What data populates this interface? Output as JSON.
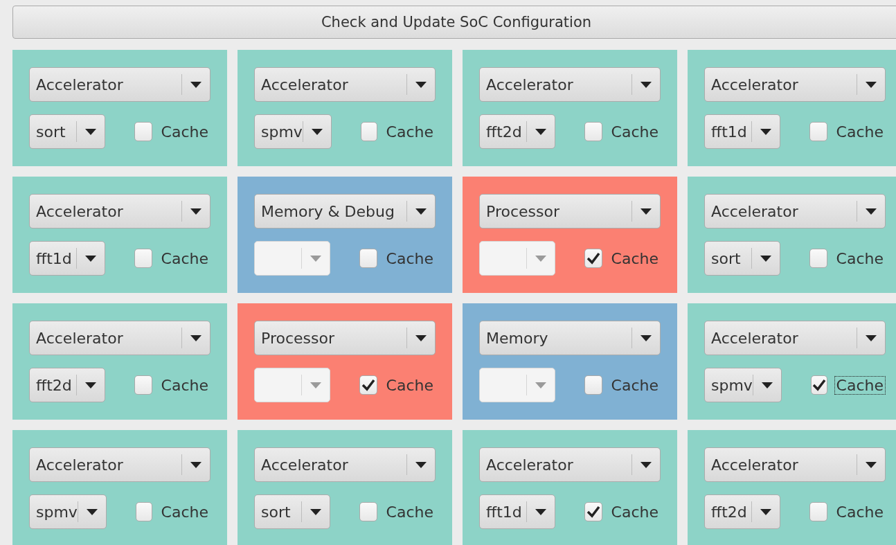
{
  "update_button": "Check and Update SoC Configuration",
  "tiles": [
    {
      "type": "Accelerator",
      "color": "#8dd3c7",
      "accelerator": "sort",
      "disabled": false,
      "cache": "Cache",
      "checked": false,
      "focused": false
    },
    {
      "type": "Accelerator",
      "color": "#8dd3c7",
      "accelerator": "spmv",
      "disabled": false,
      "cache": "Cache",
      "checked": false,
      "focused": false
    },
    {
      "type": "Accelerator",
      "color": "#8dd3c7",
      "accelerator": "fft2d",
      "disabled": false,
      "cache": "Cache",
      "checked": false,
      "focused": false
    },
    {
      "type": "Accelerator",
      "color": "#8dd3c7",
      "accelerator": "fft1d",
      "disabled": false,
      "cache": "Cache",
      "checked": false,
      "focused": false
    },
    {
      "type": "Accelerator",
      "color": "#8dd3c7",
      "accelerator": "fft1d",
      "disabled": false,
      "cache": "Cache",
      "checked": false,
      "focused": false
    },
    {
      "type": "Memory & Debug",
      "color": "#80b1d3",
      "disabled": true,
      "cache": "Cache",
      "checked": false,
      "focused": false
    },
    {
      "type": "Processor",
      "color": "#fb8072",
      "disabled": true,
      "cache": "Cache",
      "checked": true,
      "focused": false
    },
    {
      "type": "Accelerator",
      "color": "#8dd3c7",
      "accelerator": "sort",
      "disabled": false,
      "cache": "Cache",
      "checked": false,
      "focused": false
    },
    {
      "type": "Accelerator",
      "color": "#8dd3c7",
      "accelerator": "fft2d",
      "disabled": false,
      "cache": "Cache",
      "checked": false,
      "focused": false
    },
    {
      "type": "Processor",
      "color": "#fb8072",
      "disabled": true,
      "cache": "Cache",
      "checked": true,
      "focused": false
    },
    {
      "type": "Memory",
      "color": "#80b1d3",
      "disabled": true,
      "cache": "Cache",
      "checked": false,
      "focused": false
    },
    {
      "type": "Accelerator",
      "color": "#8dd3c7",
      "accelerator": "spmv",
      "disabled": false,
      "cache": "Cache",
      "checked": true,
      "focused": true
    },
    {
      "type": "Accelerator",
      "color": "#8dd3c7",
      "accelerator": "spmv",
      "disabled": false,
      "cache": "Cache",
      "checked": false,
      "focused": false
    },
    {
      "type": "Accelerator",
      "color": "#8dd3c7",
      "accelerator": "sort",
      "disabled": false,
      "cache": "Cache",
      "checked": false,
      "focused": false
    },
    {
      "type": "Accelerator",
      "color": "#8dd3c7",
      "accelerator": "fft1d",
      "disabled": false,
      "cache": "Cache",
      "checked": true,
      "focused": false
    },
    {
      "type": "Accelerator",
      "color": "#8dd3c7",
      "accelerator": "fft2d",
      "disabled": false,
      "cache": "Cache",
      "checked": false,
      "focused": false
    }
  ]
}
